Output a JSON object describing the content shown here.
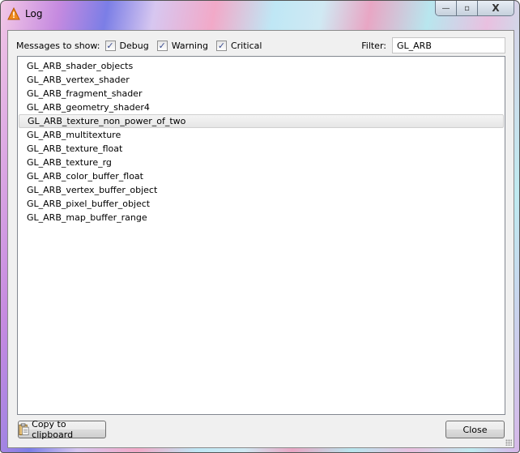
{
  "window": {
    "title": "Log",
    "icon": "warning-icon"
  },
  "caption": {
    "minimize": "—",
    "maximize": "▫",
    "close": "X"
  },
  "filters": {
    "label": "Messages to show:",
    "debug": {
      "label": "Debug",
      "checked": true
    },
    "warning": {
      "label": "Warning",
      "checked": true
    },
    "critical": {
      "label": "Critical",
      "checked": true
    },
    "filter_label": "Filter:",
    "filter_value": "GL_ARB"
  },
  "messages": [
    "GL_ARB_shader_objects",
    "GL_ARB_vertex_shader",
    "GL_ARB_fragment_shader",
    "GL_ARB_geometry_shader4",
    "GL_ARB_texture_non_power_of_two",
    "GL_ARB_multitexture",
    "GL_ARB_texture_float",
    "GL_ARB_texture_rg",
    "GL_ARB_color_buffer_float",
    "GL_ARB_vertex_buffer_object",
    "GL_ARB_pixel_buffer_object",
    "GL_ARB_map_buffer_range"
  ],
  "selected_index": 4,
  "buttons": {
    "copy": "Copy to clipboard",
    "close": "Close"
  }
}
